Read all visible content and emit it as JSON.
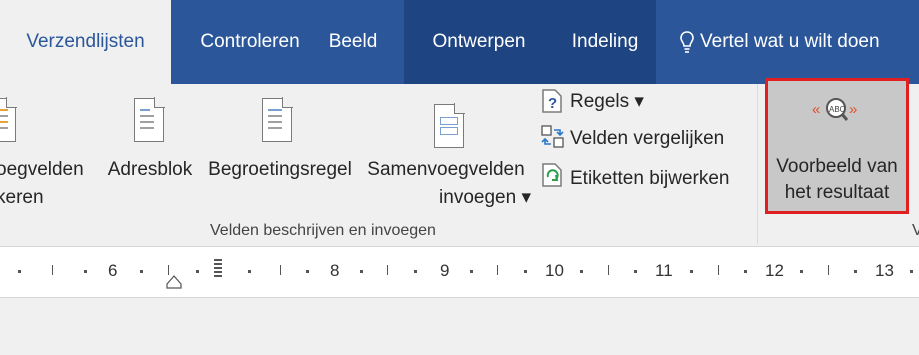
{
  "tabs": {
    "t1": "Verzendlijsten",
    "t2": "Controleren",
    "t3": "Beeld",
    "t4": "Ontwerpen",
    "t5": "Indeling",
    "tell": "Vertel wat u wilt doen"
  },
  "ribbon": {
    "merge_fields_line1": "oegvelden",
    "merge_fields_line2": "keren",
    "address_block": "Adresblok",
    "greeting_line": "Begroetingsregel",
    "insert_merge_line1": "Samenvoegvelden",
    "insert_merge_line2": "invoegen ▾",
    "rules": "Regels ▾",
    "match_fields": "Velden vergelijken",
    "update_labels": "Etiketten bijwerken",
    "preview_line1": "Voorbeeld van",
    "preview_line2": "het resultaat",
    "group_label": "Velden beschrijven en invoegen",
    "group_label_right": "V"
  },
  "ruler": {
    "n6": "6",
    "n8": "8",
    "n9": "9",
    "n10": "10",
    "n11": "11",
    "n12": "12",
    "n13": "13"
  },
  "colors": {
    "ribbon_blue": "#2b579a",
    "highlight_red": "#e02020"
  }
}
